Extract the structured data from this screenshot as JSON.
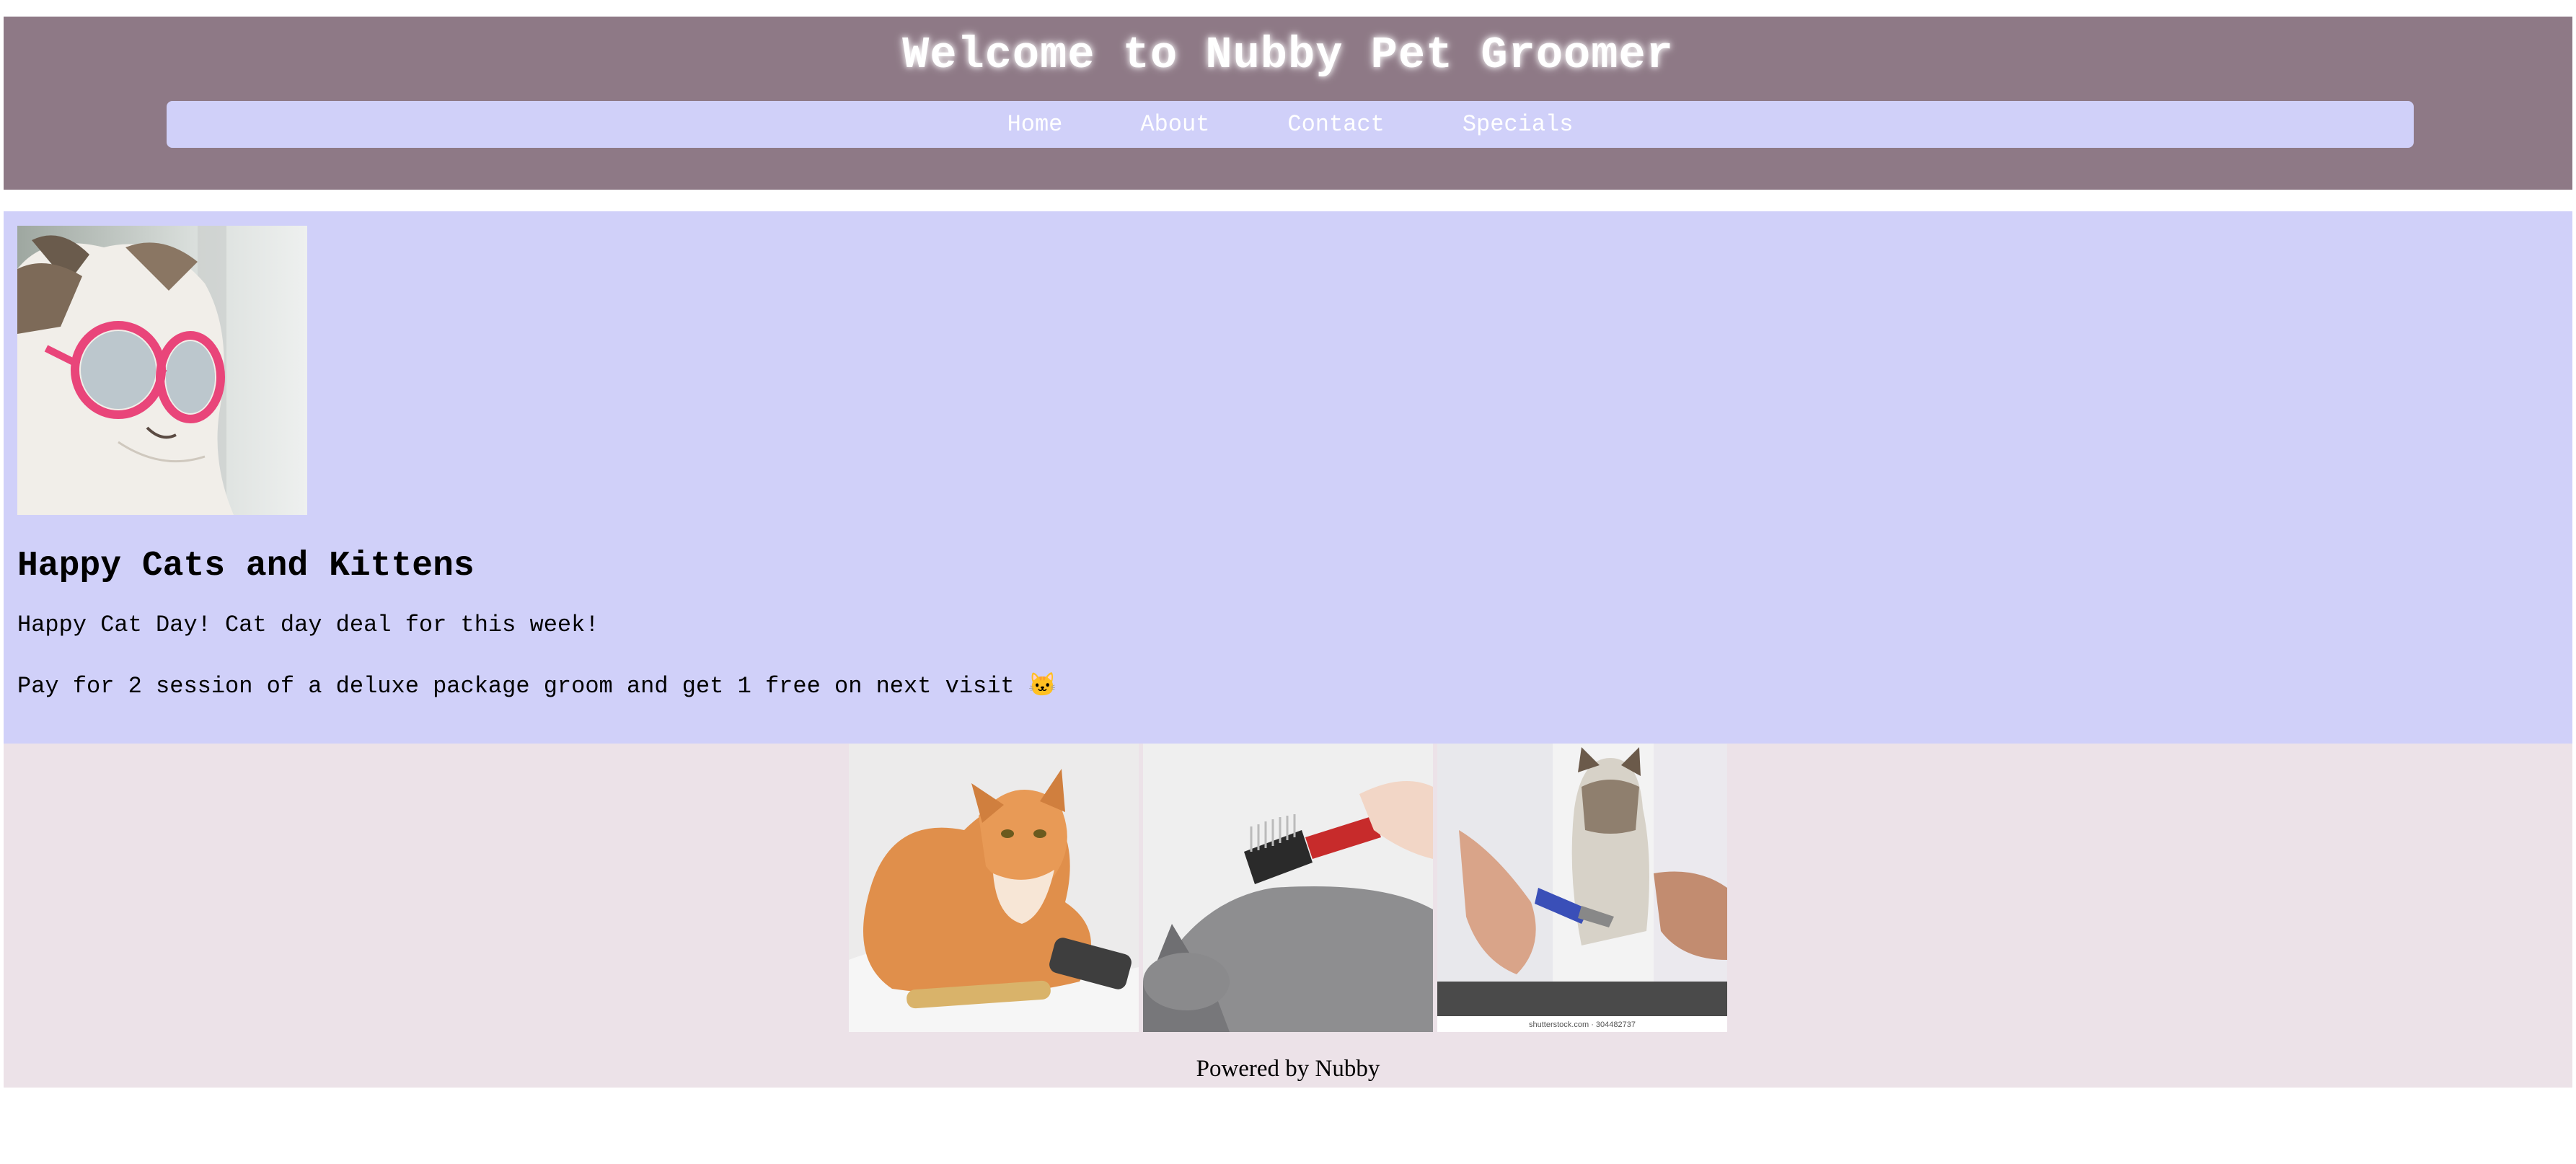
{
  "header": {
    "title": "Welcome to Nubby Pet Groomer",
    "nav": [
      "Home",
      "About",
      "Contact",
      "Specials"
    ]
  },
  "main": {
    "heading": "Happy Cats and Kittens",
    "paragraph1": "Happy Cat Day! Cat day deal for this week!",
    "paragraph2": "Pay for 2 session of a deluxe package groom and get 1 free on next visit 🐱"
  },
  "gallery": {
    "watermark": "shutterstock.com · 304482737"
  },
  "footer": {
    "text": "Powered by Nubby"
  },
  "colors": {
    "header_bg": "#8e7986",
    "nav_bg": "#d0d0f9",
    "main_bg": "#d0d0f9",
    "gallery_bg": "#ece2e8"
  }
}
